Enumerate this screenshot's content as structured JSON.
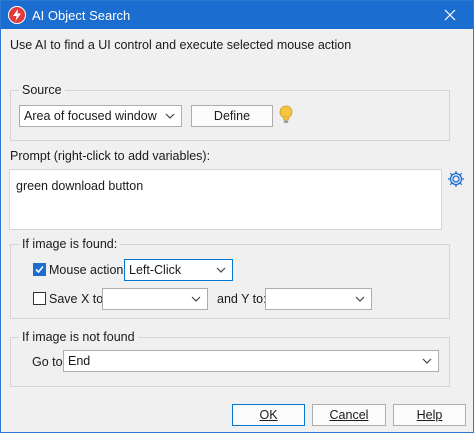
{
  "window": {
    "title": "AI Object Search"
  },
  "intro_text": "Use AI to find a UI control and execute selected mouse action",
  "source": {
    "group_label": "Source",
    "selected": "Area of focused window",
    "define_label": "Define"
  },
  "prompt": {
    "label": "Prompt (right-click to add variables):",
    "value": "green  download button"
  },
  "found": {
    "group_label": "If image is found:",
    "mouse_action_label": "Mouse action:",
    "mouse_action_checked": true,
    "mouse_action_value": "Left-Click",
    "save_x_label": "Save X to:",
    "save_x_checked": false,
    "save_x_value": "",
    "and_y_label": "and Y to:",
    "y_value": ""
  },
  "not_found": {
    "group_label": "If image is not found",
    "goto_label": "Go to",
    "goto_value": "End"
  },
  "buttons": {
    "ok": "OK",
    "cancel": "Cancel",
    "help": "Help"
  },
  "colors": {
    "titlebar": "#1c6dd0",
    "accent": "#0078d7",
    "bulb": "#f5c542"
  }
}
